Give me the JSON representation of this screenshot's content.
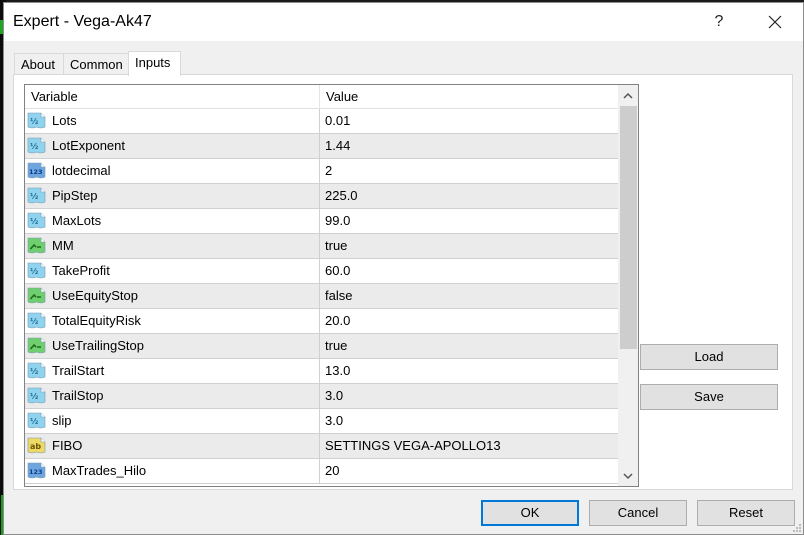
{
  "window": {
    "title": "Expert - Vega-Ak47",
    "help_label": "?",
    "close_icon": "close-icon"
  },
  "tabs": [
    {
      "label": "About",
      "active": false
    },
    {
      "label": "Common",
      "active": false
    },
    {
      "label": "Inputs",
      "active": true
    }
  ],
  "grid": {
    "columns": {
      "variable": "Variable",
      "value": "Value"
    },
    "rows": [
      {
        "icon": "double-type-icon",
        "variable": "Lots",
        "value": "0.01"
      },
      {
        "icon": "double-type-icon",
        "variable": "LotExponent",
        "value": "1.44"
      },
      {
        "icon": "integer-type-icon",
        "variable": "lotdecimal",
        "value": "2"
      },
      {
        "icon": "double-type-icon",
        "variable": "PipStep",
        "value": "225.0"
      },
      {
        "icon": "double-type-icon",
        "variable": "MaxLots",
        "value": "99.0"
      },
      {
        "icon": "bool-type-icon",
        "variable": "MM",
        "value": "true"
      },
      {
        "icon": "double-type-icon",
        "variable": "TakeProfit",
        "value": "60.0"
      },
      {
        "icon": "bool-type-icon",
        "variable": "UseEquityStop",
        "value": "false"
      },
      {
        "icon": "double-type-icon",
        "variable": "TotalEquityRisk",
        "value": "20.0"
      },
      {
        "icon": "bool-type-icon",
        "variable": "UseTrailingStop",
        "value": "true"
      },
      {
        "icon": "double-type-icon",
        "variable": "TrailStart",
        "value": "13.0"
      },
      {
        "icon": "double-type-icon",
        "variable": "TrailStop",
        "value": "3.0"
      },
      {
        "icon": "double-type-icon",
        "variable": "slip",
        "value": "3.0"
      },
      {
        "icon": "string-type-icon",
        "variable": "FIBO",
        "value": "SETTINGS VEGA-APOLLO13"
      },
      {
        "icon": "integer-type-icon",
        "variable": "MaxTrades_Hilo",
        "value": "20"
      }
    ]
  },
  "icon_glyphs": {
    "double-type-icon": "½",
    "integer-type-icon": "123",
    "bool-type-icon": "⌐",
    "string-type-icon": "ab"
  },
  "colors": {
    "double_icon": "#8fd3ee",
    "integer_icon": "#6fa6e0",
    "bool_icon": "#6fcf6f",
    "string_icon": "#eed866",
    "ok_focus_border": "#0078d7"
  },
  "buttons": {
    "load": "Load",
    "save": "Save",
    "ok": "OK",
    "cancel": "Cancel",
    "reset": "Reset"
  }
}
